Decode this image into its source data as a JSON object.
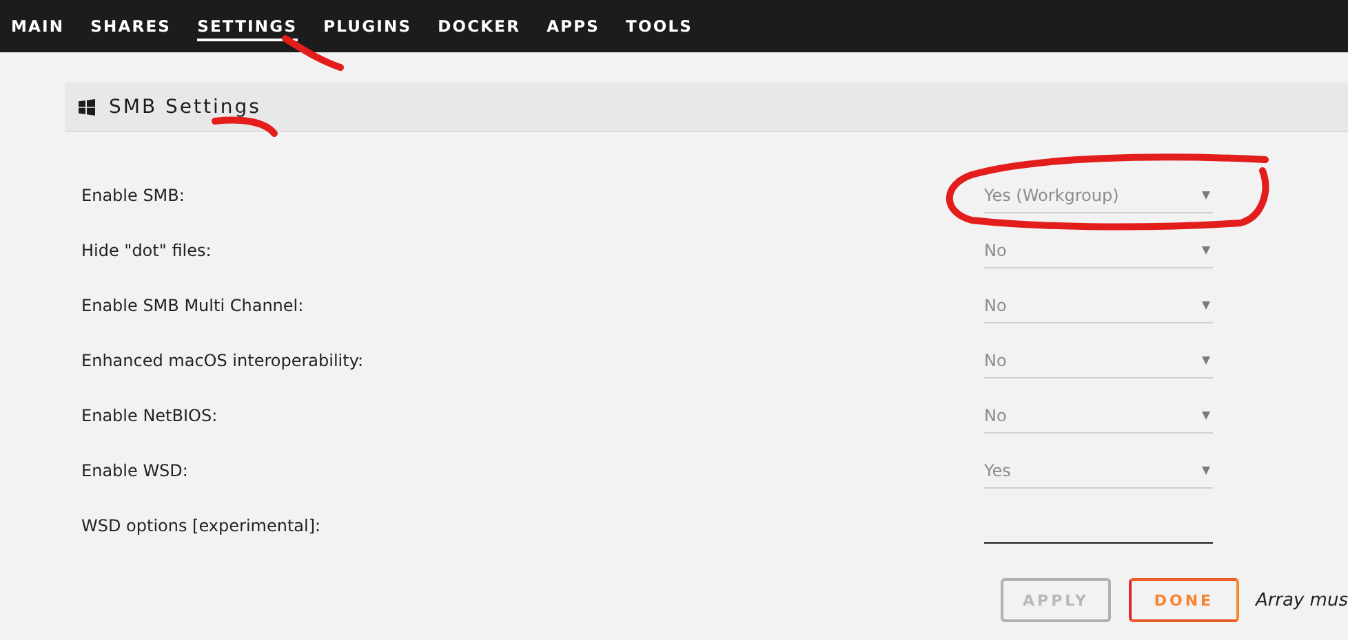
{
  "nav": [
    {
      "label": "MAIN",
      "selected": false
    },
    {
      "label": "SHARES",
      "selected": false
    },
    {
      "label": "SETTINGS",
      "selected": true
    },
    {
      "label": "PLUGINS",
      "selected": false
    },
    {
      "label": "DOCKER",
      "selected": false
    },
    {
      "label": "APPS",
      "selected": false
    },
    {
      "label": "TOOLS",
      "selected": false
    }
  ],
  "section": {
    "title": "SMB Settings"
  },
  "settings": [
    {
      "label": "Enable SMB:",
      "kind": "select",
      "value": "Yes (Workgroup)"
    },
    {
      "label": "Hide \"dot\" files:",
      "kind": "select",
      "value": "No"
    },
    {
      "label": "Enable SMB Multi Channel:",
      "kind": "select",
      "value": "No"
    },
    {
      "label": "Enhanced macOS interoperability:",
      "kind": "select",
      "value": "No"
    },
    {
      "label": "Enable NetBIOS:",
      "kind": "select",
      "value": "No"
    },
    {
      "label": "Enable WSD:",
      "kind": "select",
      "value": "Yes"
    },
    {
      "label": "WSD options [experimental]:",
      "kind": "text"
    }
  ],
  "buttons": [
    {
      "label": "APPLY",
      "kind": "plain",
      "disabled": true
    },
    {
      "label": "DONE",
      "kind": "accent",
      "disabled": false
    }
  ],
  "note": "Array mus"
}
